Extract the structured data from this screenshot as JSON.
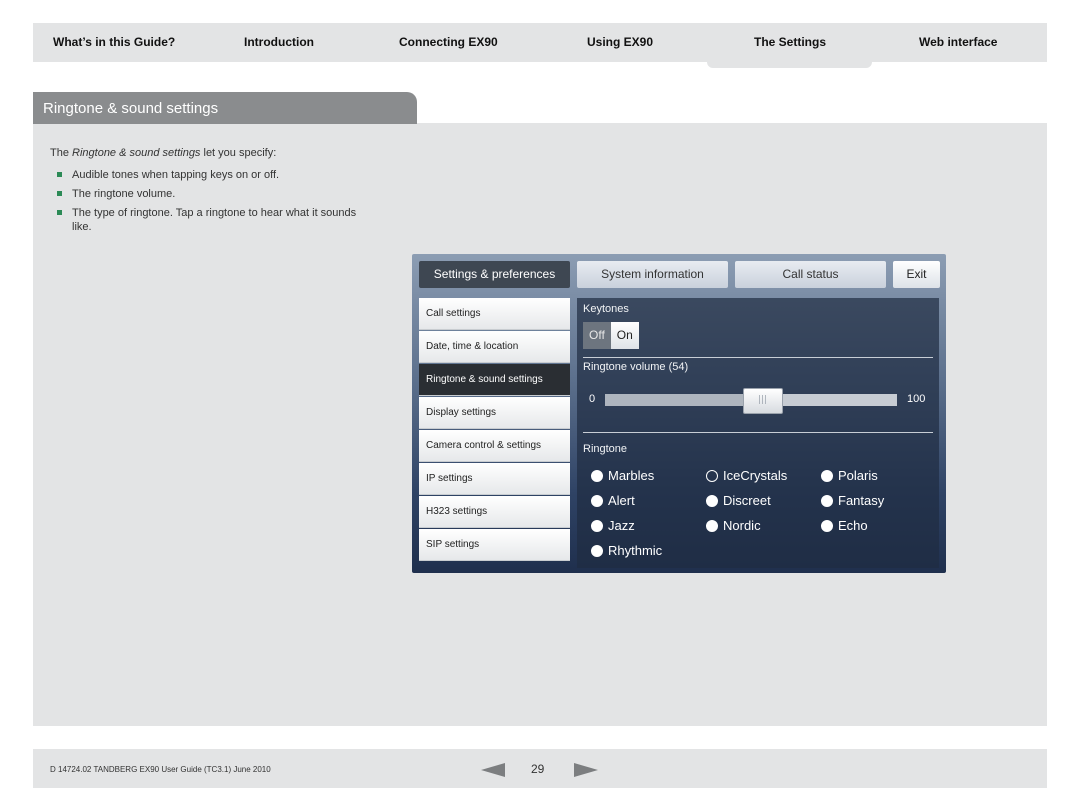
{
  "nav": {
    "tabs": [
      {
        "label": "What’s in this Guide?"
      },
      {
        "label": "Introduction"
      },
      {
        "label": "Connecting EX90"
      },
      {
        "label": "Using EX90"
      },
      {
        "label": "The Settings",
        "active": true
      },
      {
        "label": "Web interface"
      }
    ]
  },
  "section": {
    "title": "Ringtone & sound settings",
    "intro_prefix": "The ",
    "intro_emph": "Ringtone & sound settings",
    "intro_suffix": " let you specify:",
    "bullets": [
      "Audible tones when tapping keys on or off.",
      "The ringtone volume.",
      "The type of ringtone. Tap a ringtone to hear what it sounds like."
    ]
  },
  "device": {
    "tabs": [
      "Settings & preferences",
      "System information",
      "Call status"
    ],
    "exit_label": "Exit",
    "sidebar": [
      "Call settings",
      "Date, time & location",
      "Ringtone & sound settings",
      "Display settings",
      "Camera control & settings",
      "IP settings",
      "H323 settings",
      "SIP settings"
    ],
    "keytones": {
      "label": "Keytones",
      "off": "Off",
      "on": "On",
      "state": "on"
    },
    "volume": {
      "label": "Ringtone volume (54)",
      "min": "0",
      "max": "100",
      "value": 54
    },
    "ringtone": {
      "label": "Ringtone",
      "options": [
        "Marbles",
        "IceCrystals",
        "Polaris",
        "Alert",
        "Discreet",
        "Fantasy",
        "Jazz",
        "Nordic",
        "Echo",
        "Rhythmic"
      ],
      "selected": "IceCrystals"
    }
  },
  "footer": {
    "doc_id": "D 14724.02 TANDBERG EX90 User Guide (TC3.1) June 2010",
    "page": "29"
  }
}
